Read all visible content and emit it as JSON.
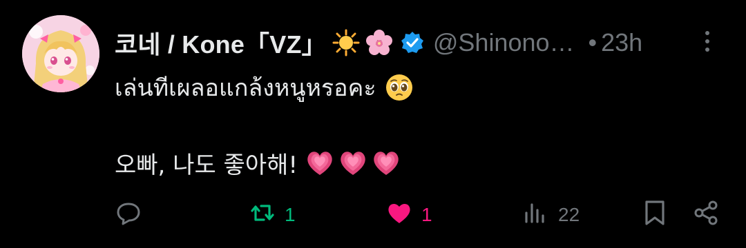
{
  "post": {
    "display_name": "코네 / Kone「VZ」",
    "handle": "@Shinono…",
    "separator": "•",
    "time": "23h",
    "badges": [
      "sun-emoji",
      "cherry-blossom-emoji",
      "verified-badge-icon"
    ],
    "text_line1": "เล่นทีเผลอแกล้งหนูหรอคะ",
    "text_line1_emoji": "pleading-face-emoji",
    "text_line2": "오빠, 나도 좋아해!",
    "text_line2_emojis": [
      "growing-heart-emoji",
      "growing-heart-emoji",
      "growing-heart-emoji"
    ]
  },
  "actions": {
    "reply": {
      "icon": "reply-icon",
      "count": ""
    },
    "repost": {
      "icon": "repost-icon",
      "count": "1",
      "color": "#00ba7c"
    },
    "like": {
      "icon": "heart-icon",
      "count": "1",
      "color": "#f91880"
    },
    "views": {
      "icon": "views-icon",
      "count": "22"
    },
    "bookmark": {
      "icon": "bookmark-icon"
    },
    "share": {
      "icon": "share-icon"
    }
  },
  "colors": {
    "background": "#000000",
    "text": "#e7e9ea",
    "muted": "#71767b",
    "verified": "#1d9bf0"
  }
}
